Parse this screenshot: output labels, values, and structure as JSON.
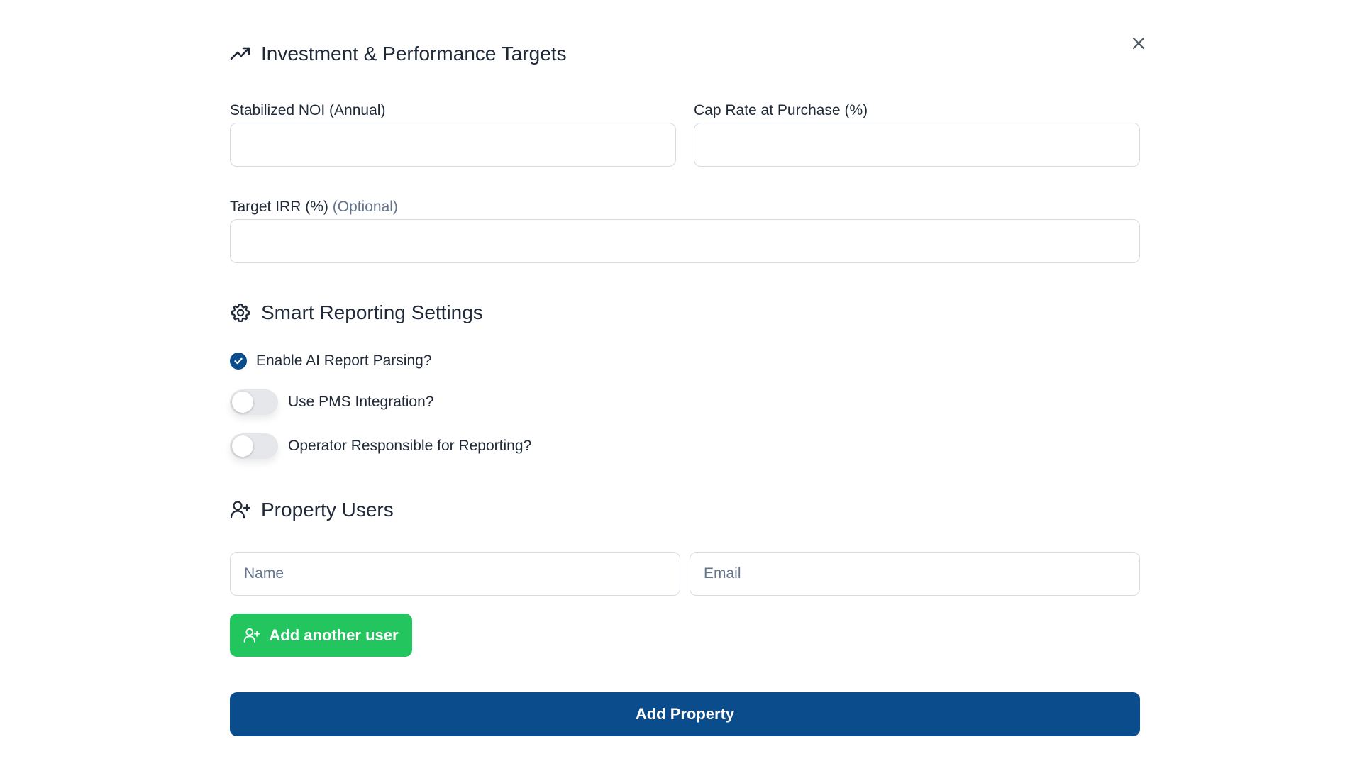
{
  "investment": {
    "title": "Investment & Performance Targets",
    "icon": "trending-up-icon",
    "noi_label": "Stabilized NOI (Annual)",
    "noi_value": "",
    "cap_rate_label": "Cap Rate at Purchase (%)",
    "cap_rate_value": "",
    "irr_label": "Target IRR (%)",
    "irr_optional": "(Optional)",
    "irr_value": ""
  },
  "reporting": {
    "title": "Smart Reporting Settings",
    "icon": "gear-icon",
    "ai_parsing_label": "Enable AI Report Parsing?",
    "ai_parsing_checked": true,
    "pms_label": "Use PMS Integration?",
    "pms_enabled": false,
    "operator_label": "Operator Responsible for Reporting?",
    "operator_enabled": false
  },
  "users": {
    "title": "Property Users",
    "icon": "user-plus-icon",
    "name_placeholder": "Name",
    "email_placeholder": "Email",
    "add_user_label": "Add another user"
  },
  "actions": {
    "submit_label": "Add Property"
  },
  "colors": {
    "primary": "#0b4c8c",
    "success": "#22c55e",
    "border": "#d6dbe3",
    "muted": "#64748b"
  }
}
